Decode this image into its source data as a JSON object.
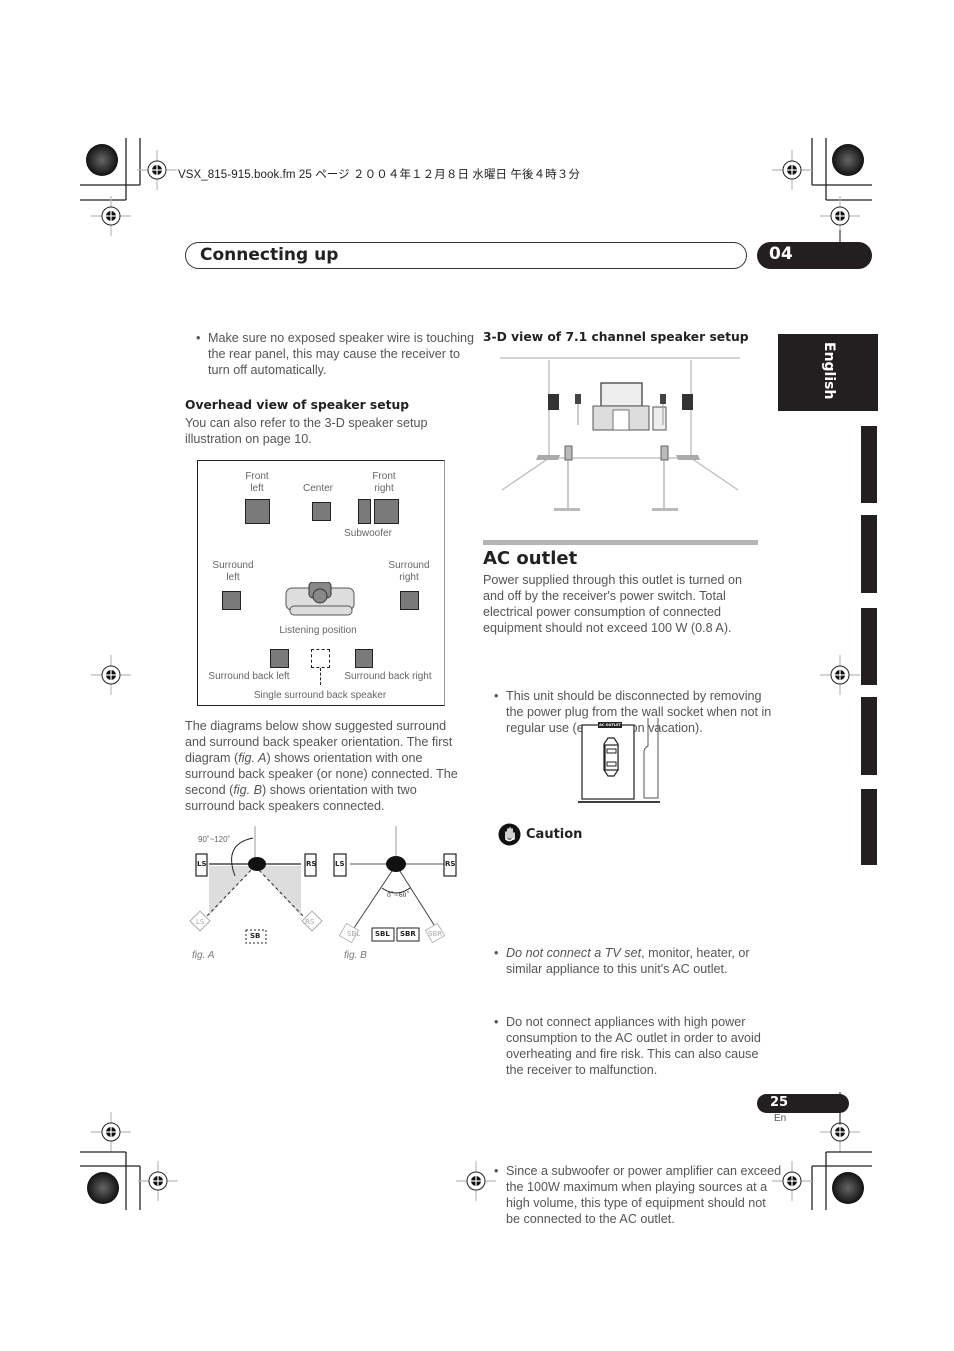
{
  "print_header": {
    "job_line": "VSX_815-915.book.fm  25 ページ  ２００４年１２月８日  水曜日  午後４時３分"
  },
  "header": {
    "section_title": "Connecting up",
    "chapter_number": "04"
  },
  "language_tab": {
    "label": "English"
  },
  "left_column": {
    "bullet_1": "Make sure no exposed speaker wire is touching the rear panel, this may cause the receiver to turn off automatically.",
    "overhead_heading": "Overhead view of speaker setup",
    "overhead_intro": "You can also refer to the 3-D speaker setup illustration on page 10.",
    "overhead_diagram": {
      "labels": {
        "front_left": "Front left",
        "center": "Center",
        "front_right": "Front right",
        "subwoofer": "Subwoofer",
        "surround_left": "Surround left",
        "surround_right": "Surround right",
        "listening_position": "Listening position",
        "surround_back_left": "Surround back  left",
        "surround_back_right": "Surround back  right",
        "single_surround_back": "Single surround back speaker"
      }
    },
    "orientation_paragraph": {
      "p1": "The diagrams below show suggested surround and surround back speaker orientation. The first diagram (",
      "fig_a": "fig. A",
      "p2": ") shows orientation with one surround back speaker (or none) connected. The second (",
      "fig_b": "fig. B",
      "p3": ") shows orientation with two surround back speakers connected."
    },
    "fig_a": {
      "angle_label": "90˚~120˚",
      "ls": "LS",
      "rs": "RS",
      "ls_angled": "LS",
      "rs_angled": "RS",
      "sb": "SB",
      "caption": "fig. A"
    },
    "fig_b": {
      "ls": "LS",
      "rs": "RS",
      "angle_label": "0˚~60˚",
      "sbl_angled": "SBL",
      "sbr_angled": "SBR",
      "sbl": "SBL",
      "sbr": "SBR",
      "caption": "fig. B"
    }
  },
  "right_column": {
    "view3d_heading": "3-D view of 7.1 channel speaker setup",
    "ac_heading": "AC outlet",
    "ac_paragraph": "Power supplied through this outlet is turned on and off by the receiver's power switch. Total electrical power consumption of connected equipment should not exceed 100 W (0.8 A).",
    "ac_bullet": "This unit should be disconnected by removing the power plug from the wall socket when not in regular use (ex. when on vacation).",
    "ac_panel_label": "AC OUTLET",
    "caution_heading": "Caution",
    "caution_items": [
      {
        "italic": "Do not connect a TV set",
        "text": ", monitor, heater, or similar appliance to this unit's AC outlet."
      },
      {
        "italic": "",
        "text": "Do not connect appliances with high power consumption to the AC outlet in order to avoid overheating and fire risk. This can also cause the receiver to malfunction."
      },
      {
        "italic": "",
        "text": "Since a subwoofer or power amplifier can exceed the 100W maximum when playing sources at a high volume, this type of equipment should not be connected to the AC outlet."
      }
    ]
  },
  "footer": {
    "page_number": "25",
    "language_code": "En"
  }
}
